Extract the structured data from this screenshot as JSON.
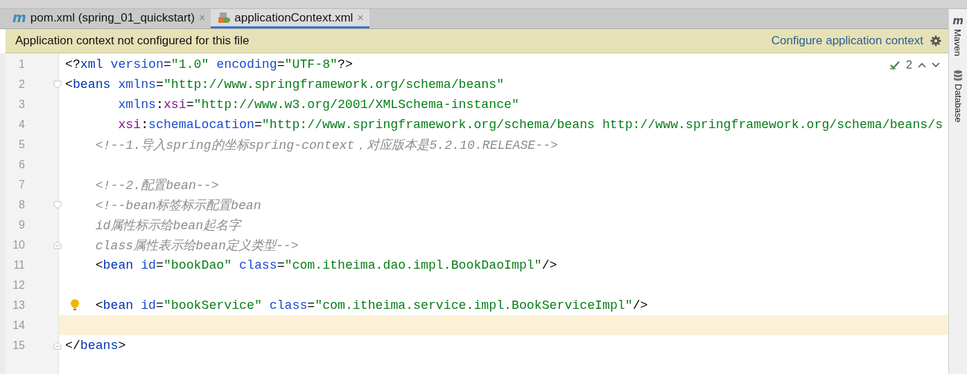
{
  "tabs": [
    {
      "badge": "m",
      "label": "pom.xml (spring_01_quickstart)",
      "close": "×",
      "selected": false
    },
    {
      "label": "applicationContext.xml",
      "close": "×",
      "selected": true
    }
  ],
  "banner": {
    "message": "Application context not configured for this file",
    "link": "Configure application context"
  },
  "inspection": {
    "count": "2"
  },
  "side_tools": [
    {
      "badge": "m",
      "label": "Maven"
    },
    {
      "label": "Database"
    }
  ],
  "lines": [
    {
      "number": "1",
      "kind": "top",
      "current": false,
      "bulb": false,
      "tokens": [
        {
          "kind": "punct",
          "text": "<?"
        },
        {
          "kind": "tag",
          "text": "xml"
        },
        {
          "kind": "attr",
          "text": " version"
        },
        {
          "kind": "punct",
          "text": "="
        },
        {
          "kind": "value",
          "text": "\"1.0\""
        },
        {
          "kind": "attr",
          "text": " encoding"
        },
        {
          "kind": "punct",
          "text": "="
        },
        {
          "kind": "value",
          "text": "\"UTF-8\""
        },
        {
          "kind": "punct",
          "text": "?>"
        }
      ]
    },
    {
      "number": "2",
      "kind": "top",
      "fold": {
        "kind": "start"
      },
      "current": false,
      "bulb": false,
      "tokens": [
        {
          "kind": "punct",
          "text": "<"
        },
        {
          "kind": "tag",
          "text": "beans"
        },
        {
          "kind": "attr",
          "text": " xmlns"
        },
        {
          "kind": "punct",
          "text": "="
        },
        {
          "kind": "value",
          "text": "\"http://www.springframework.org/schema/beans\""
        }
      ]
    },
    {
      "number": "3",
      "kind": "continuation",
      "current": false,
      "bulb": false,
      "tokens": [
        {
          "kind": "attr",
          "text": "xmlns"
        },
        {
          "kind": "punct",
          "text": ":"
        },
        {
          "kind": "ns",
          "text": "xsi"
        },
        {
          "kind": "punct",
          "text": "="
        },
        {
          "kind": "value",
          "text": "\"http://www.w3.org/2001/XMLSchema-instance\""
        }
      ]
    },
    {
      "number": "4",
      "kind": "continuation",
      "current": false,
      "bulb": false,
      "tokens": [
        {
          "kind": "ns",
          "text": "xsi"
        },
        {
          "kind": "punct",
          "text": ":"
        },
        {
          "kind": "attr",
          "text": "schemaLocation"
        },
        {
          "kind": "punct",
          "text": "="
        },
        {
          "kind": "value",
          "text": "\"http://www.springframework.org/schema/beans http://www.springframework.org/schema/beans/s"
        }
      ]
    },
    {
      "number": "5",
      "kind": "nested",
      "current": false,
      "bulb": false,
      "tokens": [
        {
          "kind": "comment",
          "text": "<!--1.导入spring的坐标spring-context，对应版本是5.2.10.RELEASE-->"
        }
      ]
    },
    {
      "number": "6",
      "current": false,
      "bulb": false
    },
    {
      "number": "7",
      "kind": "nested",
      "current": false,
      "bulb": false,
      "tokens": [
        {
          "kind": "comment",
          "text": "<!--2.配置bean-->"
        }
      ]
    },
    {
      "number": "8",
      "kind": "nested",
      "fold": {
        "kind": "start"
      },
      "current": false,
      "bulb": false,
      "tokens": [
        {
          "kind": "comment",
          "text": "<!--bean标签标示配置bean"
        }
      ]
    },
    {
      "number": "9",
      "kind": "nested",
      "current": false,
      "bulb": false,
      "tokens": [
        {
          "kind": "comment",
          "text": "id属性标示给bean起名字"
        }
      ]
    },
    {
      "number": "10",
      "kind": "nested",
      "fold": {
        "kind": "end"
      },
      "current": false,
      "bulb": false,
      "tokens": [
        {
          "kind": "comment",
          "text": "class属性表示给bean定义类型-->"
        }
      ]
    },
    {
      "number": "11",
      "kind": "nested",
      "current": false,
      "bulb": false,
      "tokens": [
        {
          "kind": "punct",
          "text": "<"
        },
        {
          "kind": "tag",
          "text": "bean"
        },
        {
          "kind": "attr",
          "text": " id"
        },
        {
          "kind": "punct",
          "text": "="
        },
        {
          "kind": "value",
          "text": "\"bookDao\""
        },
        {
          "kind": "attr",
          "text": " class"
        },
        {
          "kind": "punct",
          "text": "="
        },
        {
          "kind": "value",
          "text": "\"com.itheima.dao.impl.BookDaoImpl\""
        },
        {
          "kind": "punct",
          "text": "/>"
        }
      ]
    },
    {
      "number": "12",
      "current": false,
      "bulb": false
    },
    {
      "number": "13",
      "kind": "nested",
      "current": false,
      "bulb": true,
      "tokens": [
        {
          "kind": "punct",
          "text": "<"
        },
        {
          "kind": "tag",
          "text": "bean"
        },
        {
          "kind": "attr",
          "text": " id"
        },
        {
          "kind": "punct",
          "text": "="
        },
        {
          "kind": "value",
          "text": "\"bookService\""
        },
        {
          "kind": "attr",
          "text": " class"
        },
        {
          "kind": "punct",
          "text": "="
        },
        {
          "kind": "value",
          "text": "\"com.itheima.service.impl.BookServiceImpl\""
        },
        {
          "kind": "punct",
          "text": "/>"
        }
      ]
    },
    {
      "number": "14",
      "current": true,
      "bulb": false
    },
    {
      "number": "15",
      "kind": "top",
      "fold": {
        "kind": "end"
      },
      "current": false,
      "bulb": false,
      "tokens": [
        {
          "kind": "punct",
          "text": "</"
        },
        {
          "kind": "tag",
          "text": "beans"
        },
        {
          "kind": "punct",
          "text": ">"
        }
      ]
    }
  ]
}
